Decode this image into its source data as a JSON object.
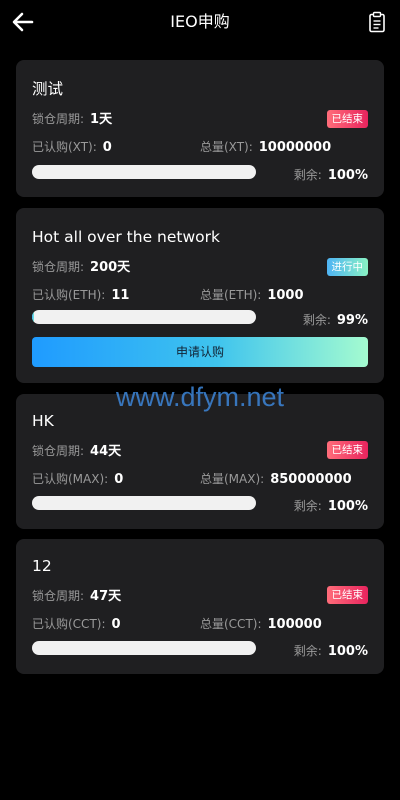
{
  "header": {
    "title": "IEO申购"
  },
  "labels": {
    "lock_period": "锁仓周期:",
    "remaining": "剩余:",
    "apply_button": "申请认购"
  },
  "cards": [
    {
      "title": "测试",
      "lock_period": "1天",
      "status": "已结束",
      "subscribed_label": "已认购(XT):",
      "subscribed_value": "0",
      "total_label": "总量(XT):",
      "total_value": "10000000",
      "remaining": "100%",
      "progress": 0
    },
    {
      "title": "Hot all over the network",
      "lock_period": "200天",
      "status": "进行中",
      "subscribed_label": "已认购(ETH):",
      "subscribed_value": "11",
      "total_label": "总量(ETH):",
      "total_value": "1000",
      "remaining": "99%",
      "progress": 0.01
    },
    {
      "title": "HK",
      "lock_period": "44天",
      "status": "已结束",
      "subscribed_label": "已认购(MAX):",
      "subscribed_value": "0",
      "total_label": "总量(MAX):",
      "total_value": "850000000",
      "remaining": "100%",
      "progress": 0
    },
    {
      "title": "12",
      "lock_period": "47天",
      "status": "已结束",
      "subscribed_label": "已认购(CCT):",
      "subscribed_value": "0",
      "total_label": "总量(CCT):",
      "total_value": "100000",
      "remaining": "100%",
      "progress": 0
    }
  ],
  "watermark": "www.dfym.net",
  "icons": {
    "back": "arrow-left-icon",
    "records": "clipboard-list-icon"
  }
}
